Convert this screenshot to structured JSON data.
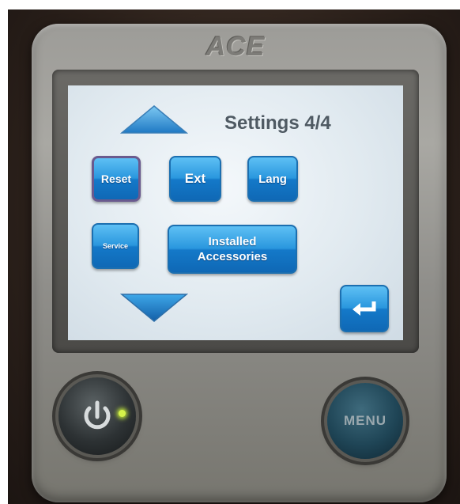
{
  "device": {
    "brand": "ACE"
  },
  "screen": {
    "title": "Settings 4/4"
  },
  "buttons": {
    "reset": "Reset",
    "ext": "Ext",
    "lang": "Lang",
    "service": "Service",
    "accessories_line1": "Installed",
    "accessories_line2": "Accessories",
    "enter_icon": "enter-icon"
  },
  "hardware": {
    "menu_label": "MENU",
    "power_icon": "power-icon"
  },
  "colors": {
    "button_blue": "#1479c9",
    "screen_bg": "#e1eaf0",
    "title_text": "#4f5a63",
    "led_green": "#d6f24a"
  }
}
